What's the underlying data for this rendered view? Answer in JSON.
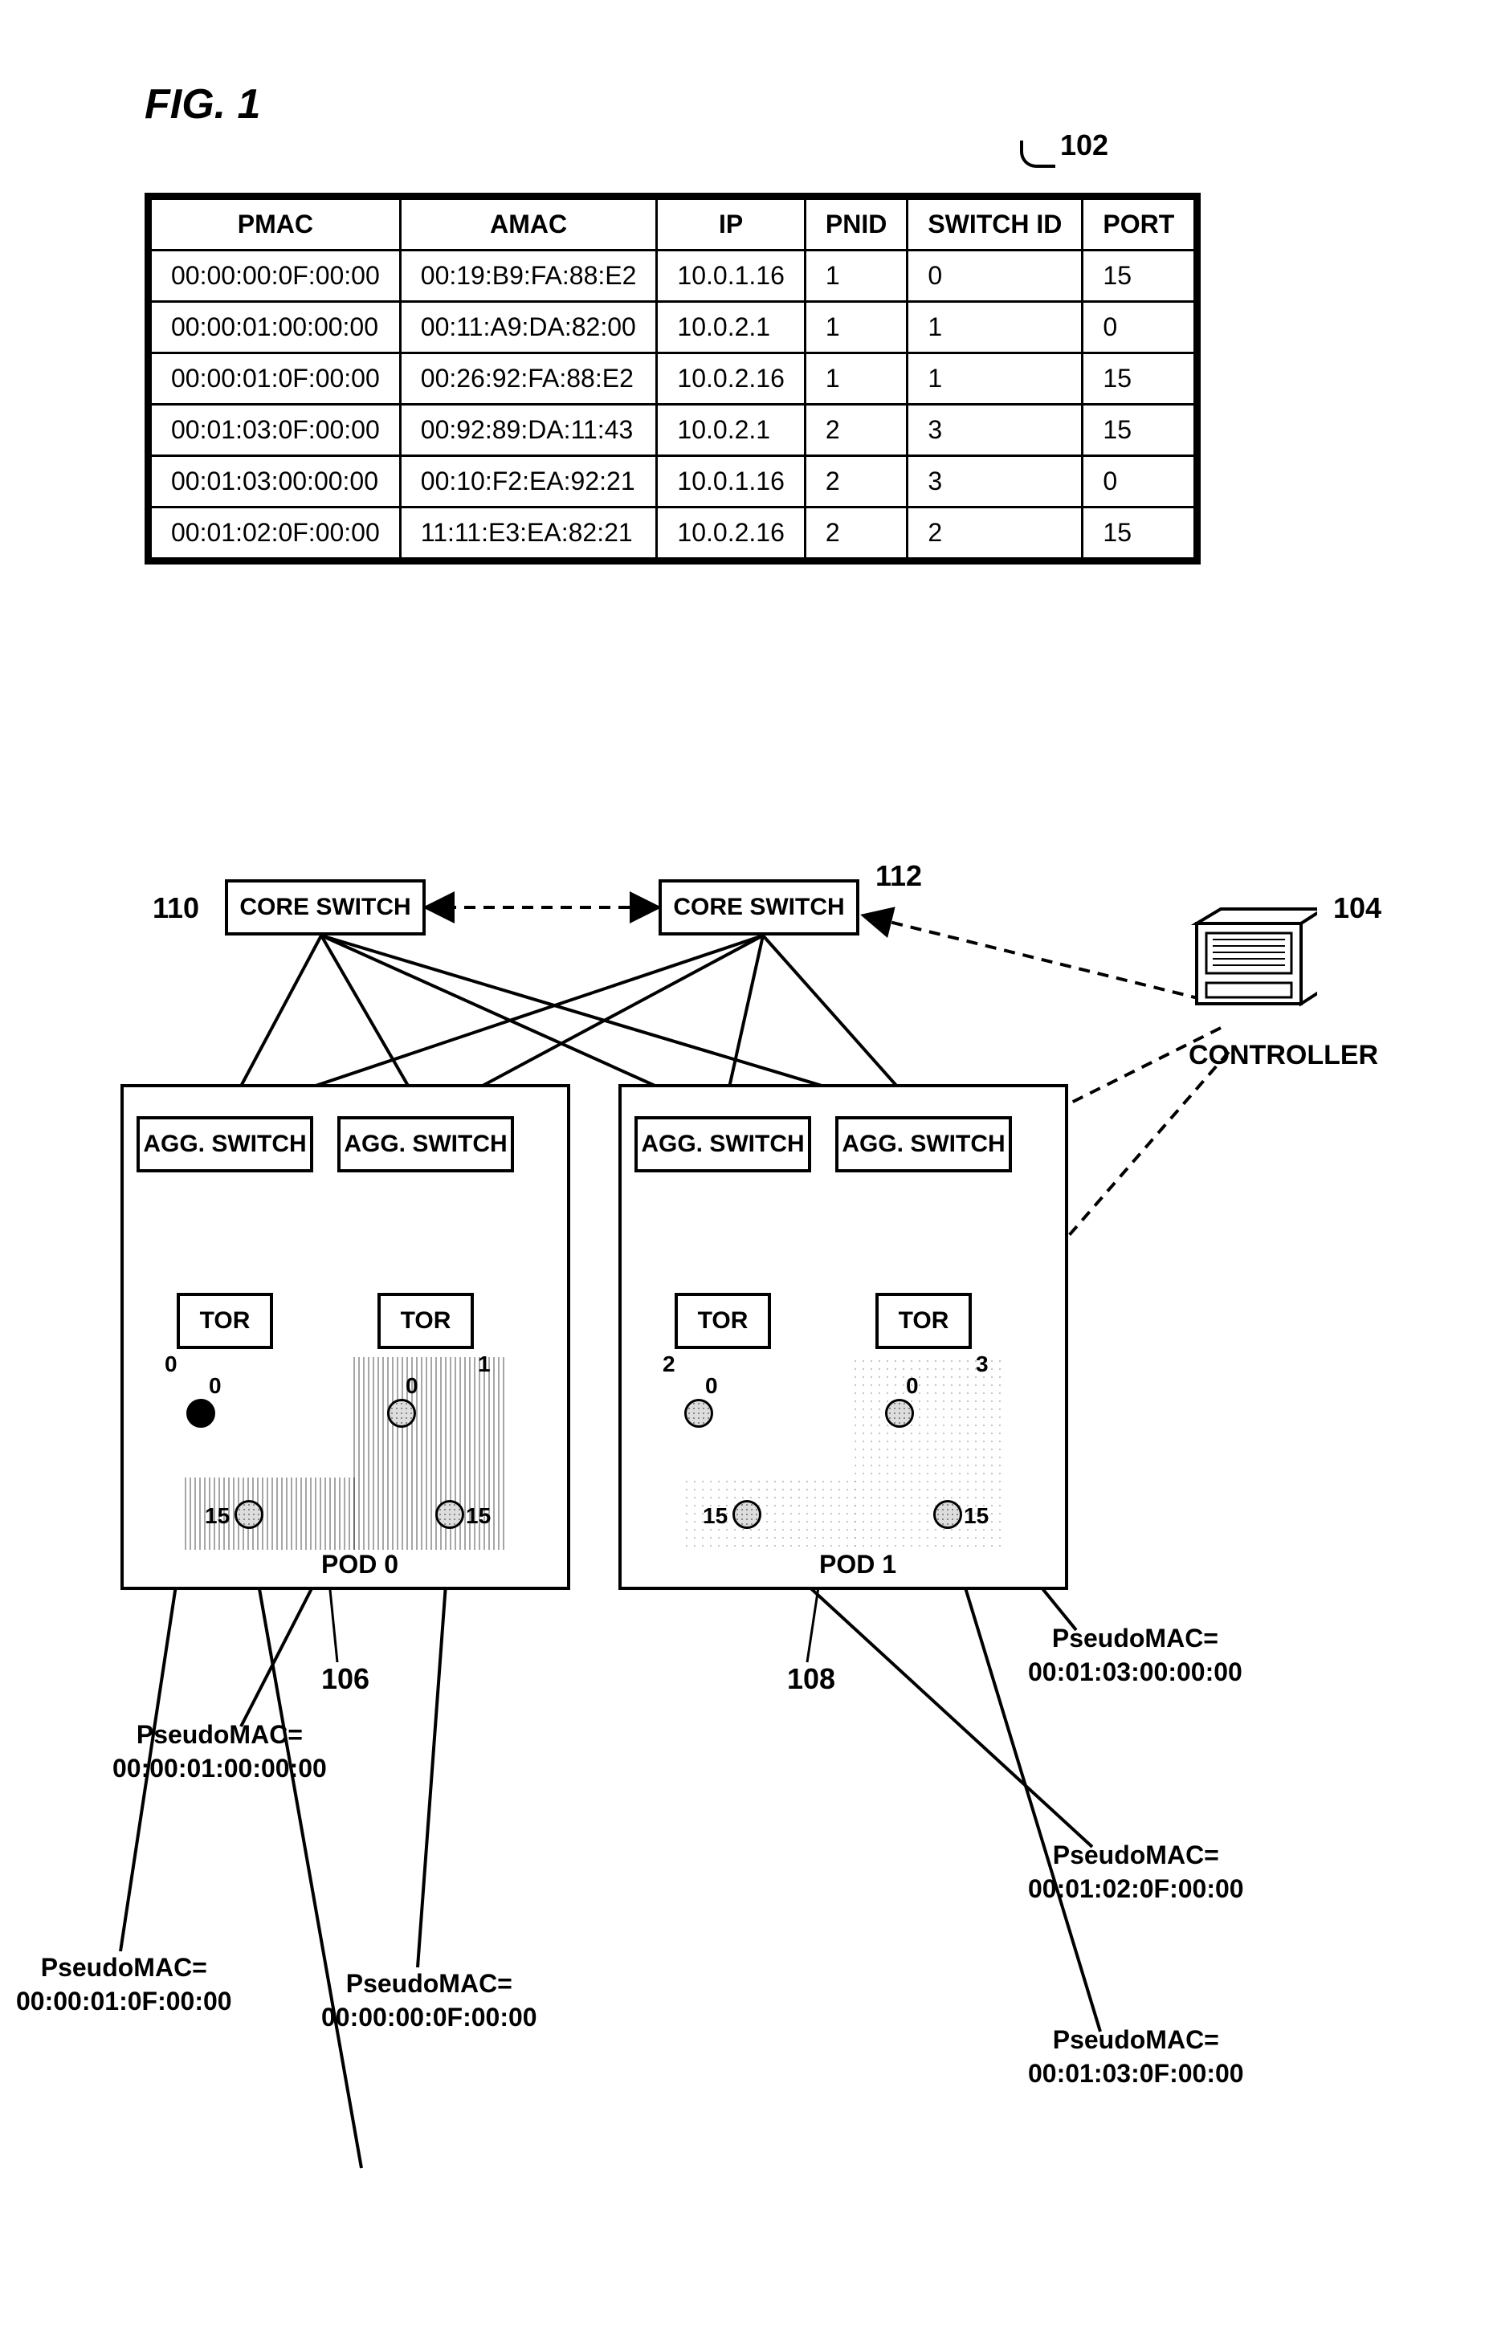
{
  "figure_label": "FIG. 1",
  "ref_102": "102",
  "ref_104": "104",
  "ref_106": "106",
  "ref_108": "108",
  "ref_110": "110",
  "ref_112": "112",
  "table": {
    "headers": [
      "PMAC",
      "AMAC",
      "IP",
      "PNID",
      "SWITCH ID",
      "PORT"
    ],
    "rows": [
      [
        "00:00:00:0F:00:00",
        "00:19:B9:FA:88:E2",
        "10.0.1.16",
        "1",
        "0",
        "15"
      ],
      [
        "00:00:01:00:00:00",
        "00:11:A9:DA:82:00",
        "10.0.2.1",
        "1",
        "1",
        "0"
      ],
      [
        "00:00:01:0F:00:00",
        "00:26:92:FA:88:E2",
        "10.0.2.16",
        "1",
        "1",
        "15"
      ],
      [
        "00:01:03:0F:00:00",
        "00:92:89:DA:11:43",
        "10.0.2.1",
        "2",
        "3",
        "15"
      ],
      [
        "00:01:03:00:00:00",
        "00:10:F2:EA:92:21",
        "10.0.1.16",
        "2",
        "3",
        "0"
      ],
      [
        "00:01:02:0F:00:00",
        "11:11:E3:EA:82:21",
        "10.0.2.16",
        "2",
        "2",
        "15"
      ]
    ]
  },
  "nodes": {
    "core_switch": "CORE SWITCH",
    "agg_switch": "AGG. SWITCH",
    "tor": "TOR",
    "controller": "CONTROLLER",
    "pod0": "POD 0",
    "pod1": "POD 1"
  },
  "ports": {
    "p0": "0",
    "p1": "1",
    "p2": "2",
    "p3": "3",
    "p15": "15"
  },
  "callouts": {
    "c1_label": "PseudoMAC=",
    "c1_val": "00:00:01:00:00:00",
    "c2_label": "PseudoMAC=",
    "c2_val": "00:00:01:0F:00:00",
    "c3_label": "PseudoMAC=",
    "c3_val": "00:00:00:0F:00:00",
    "c4_label": "PseudoMAC=",
    "c4_val": "00:01:03:00:00:00",
    "c5_label": "PseudoMAC=",
    "c5_val": "00:01:02:0F:00:00",
    "c6_label": "PseudoMAC=",
    "c6_val": "00:01:03:0F:00:00"
  },
  "chart_data": {
    "type": "diagram",
    "description": "Network topology with 2 core switches, 4 aggregation switches, 4 TOR switches across 2 pods (Pod 0, Pod 1), a controller, and a mapping table of PMAC/AMAC/IP/PNID/SwitchID/Port",
    "core_switches": 2,
    "agg_switches": 4,
    "tor_switches": [
      {
        "pod": 0,
        "id": 0,
        "ports": [
          0,
          15
        ]
      },
      {
        "pod": 0,
        "id": 1,
        "ports": [
          0,
          15
        ]
      },
      {
        "pod": 1,
        "id": 2,
        "ports": [
          0,
          15
        ]
      },
      {
        "pod": 1,
        "id": 3,
        "ports": [
          0,
          15
        ]
      }
    ],
    "pods": [
      "POD 0",
      "POD 1"
    ],
    "controller_connects_to": [
      "core_switch_right",
      "agg_switches_pod1",
      "tor_switches_pod1"
    ],
    "pseudo_macs": {
      "pod0_tor0_port0": null,
      "pod0_tor0_port15": "00:00:00:0F:00:00",
      "pod0_tor1_port0": "00:00:01:00:00:00",
      "pod0_tor1_port15": "00:00:01:0F:00:00",
      "pod1_tor2_port0": null,
      "pod1_tor2_port15": "00:01:02:0F:00:00",
      "pod1_tor3_port0": "00:01:03:00:00:00",
      "pod1_tor3_port15": "00:01:03:0F:00:00"
    }
  }
}
